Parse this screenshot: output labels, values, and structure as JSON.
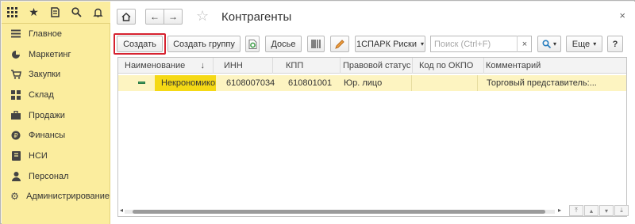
{
  "sidebar": {
    "items": [
      {
        "label": "Главное",
        "icon": "menu-lines-icon"
      },
      {
        "label": "Маркетинг",
        "icon": "pie-chart-icon"
      },
      {
        "label": "Закупки",
        "icon": "cart-icon"
      },
      {
        "label": "Склад",
        "icon": "warehouse-icon"
      },
      {
        "label": "Продажи",
        "icon": "briefcase-icon"
      },
      {
        "label": "Финансы",
        "icon": "ruble-coin-icon"
      },
      {
        "label": "НСИ",
        "icon": "book-icon"
      },
      {
        "label": "Персонал",
        "icon": "person-icon"
      },
      {
        "label": "Администрирование",
        "icon": "gear-icon"
      }
    ]
  },
  "header": {
    "title": "Контрагенты"
  },
  "toolbar": {
    "create_label": "Создать",
    "create_group_label": "Создать группу",
    "dossier_label": "Досье",
    "spark_label": "1СПАРК Риски",
    "search_placeholder": "Поиск (Ctrl+F)",
    "more_label": "Еще",
    "help_label": "?"
  },
  "table": {
    "columns": [
      "Наименование",
      "ИНН",
      "КПП",
      "Правовой статус",
      "Код по ОКПО",
      "Комментарий"
    ],
    "sort_indicator": "↓",
    "rows": [
      {
        "name": "Некрономикон",
        "inn": "6108007034",
        "kpp": "610801001",
        "status": "Юр. лицо",
        "okpo": "",
        "comment": "Торговый представитель:..."
      }
    ]
  },
  "colors": {
    "sidebar_bg": "#fbed9e",
    "selected_cell": "#f5d915",
    "row_bg": "#fdf4c1",
    "highlight_border": "#d6222f"
  }
}
